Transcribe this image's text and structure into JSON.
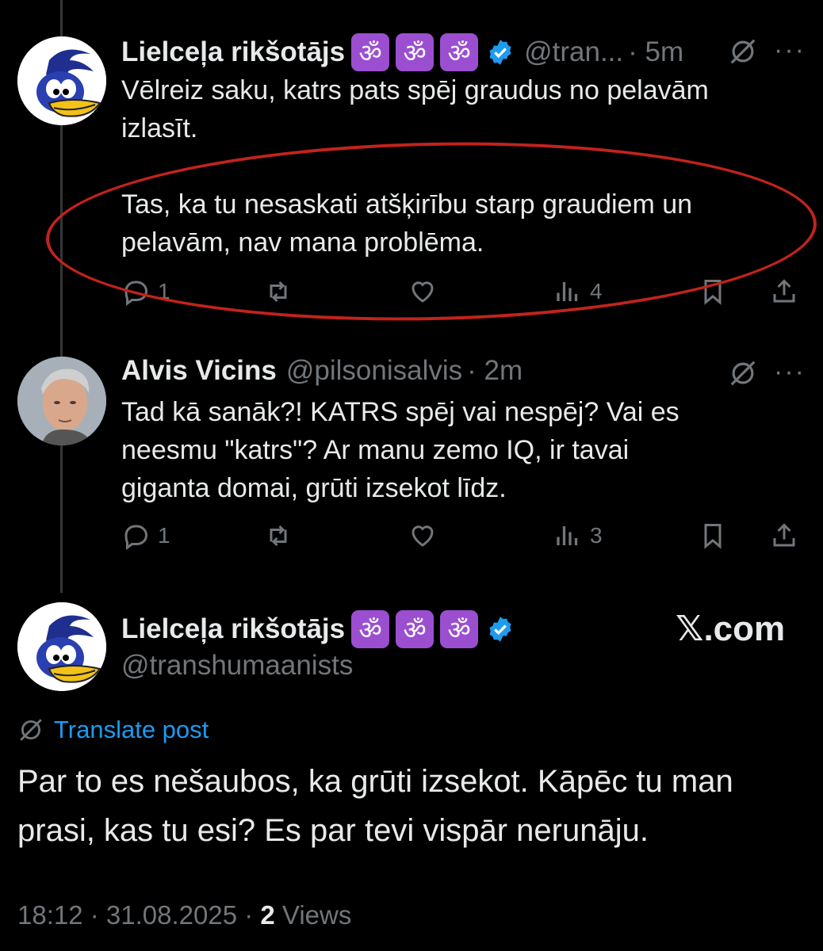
{
  "tweets": [
    {
      "name": "Lielceļa rikšotājs",
      "emojis": [
        "ॐ",
        "ॐ",
        "ॐ"
      ],
      "handle": "@tran...",
      "time": "· 5m",
      "more": "···",
      "text": "Vēlreiz saku, katrs pats spēj graudus no pelavām\nizlasīt.\n\nTas, ka tu nesaskati atšķirību starp graudiem un\npelavām, nav mana problēma.",
      "replies": "1",
      "views": "4"
    },
    {
      "name": "Alvis Vicins",
      "handle": "@pilsonisalvis",
      "time": "· 2m",
      "more": "···",
      "text": "Tad kā sanāk?! KATRS spēj vai nespēj? Vai es\nneesmu \"katrs\"? Ar manu zemo IQ, ir tavai\ngiganta domai, grūti izsekot līdz.",
      "replies": "1",
      "views": "3"
    }
  ],
  "main": {
    "name": "Lielceļa rikšotājs",
    "emojis": [
      "ॐ",
      "ॐ",
      "ॐ"
    ],
    "handle": "@transhumaanists",
    "watermark": "𝕏.com",
    "translate": "Translate post",
    "text": "Par to es nešaubos, ka grūti izsekot. Kāpēc tu man prasi, kas tu esi? Es par tevi vispār nerunāju.",
    "time": "18:12 · 31.08.2025 · ",
    "views_count": "2",
    "views_label": " Views"
  },
  "colors": {
    "background": "#000000",
    "text": "#e7e9ea",
    "muted": "#71767b",
    "link": "#1d9bf0",
    "verified": "#1d9bf0",
    "highlight": "#c2231c",
    "emoji_bg": "#9b4fd0"
  }
}
